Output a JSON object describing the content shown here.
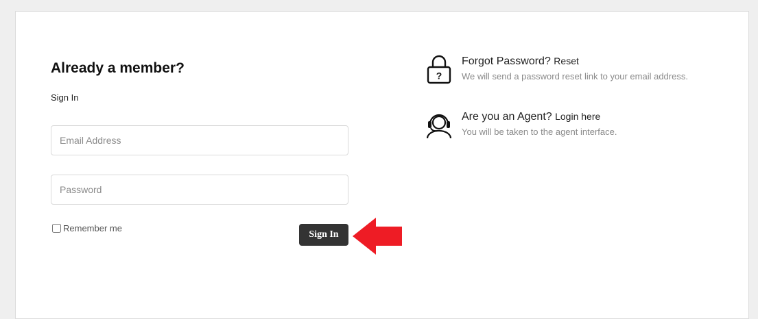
{
  "login": {
    "heading": "Already a member?",
    "subheading": "Sign In",
    "email_placeholder": "Email Address",
    "password_placeholder": "Password",
    "remember_label": "Remember me",
    "signin_label": "Sign In"
  },
  "side": {
    "forgot": {
      "title": "Forgot Password?",
      "link": "Reset",
      "description": "We will send a password reset link to your email address.",
      "icon": "padlock-question-icon"
    },
    "agent": {
      "title": "Are you an Agent?",
      "link": "Login here",
      "description": "You will be taken to the agent interface.",
      "icon": "headset-agent-icon"
    }
  },
  "annotation": {
    "arrow_color": "#ee1c25",
    "icon": "red-arrow-left-icon"
  },
  "colors": {
    "button_bg": "#333333",
    "page_bg": "#efefef",
    "card_bg": "#ffffff"
  }
}
